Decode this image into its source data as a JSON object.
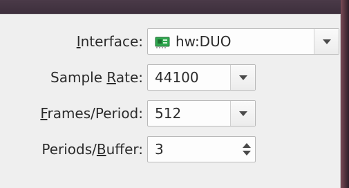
{
  "form": {
    "interface": {
      "label_prefix": "",
      "label_underlined": "I",
      "label_suffix": "nterface:",
      "value": "hw:DUO",
      "icon": "sound-card-icon"
    },
    "sample_rate": {
      "label_prefix": "Sample ",
      "label_underlined": "R",
      "label_suffix": "ate:",
      "value": "44100"
    },
    "frames_period": {
      "label_prefix": "",
      "label_underlined": "F",
      "label_suffix": "rames/Period:",
      "value": "512"
    },
    "periods_buffer": {
      "label_prefix": "Periods/",
      "label_underlined": "B",
      "label_suffix": "uffer:",
      "value": "3"
    }
  },
  "colors": {
    "panel_background": "#efefef",
    "field_border": "#b9b9b9",
    "icon_green": "#2fa84f"
  }
}
